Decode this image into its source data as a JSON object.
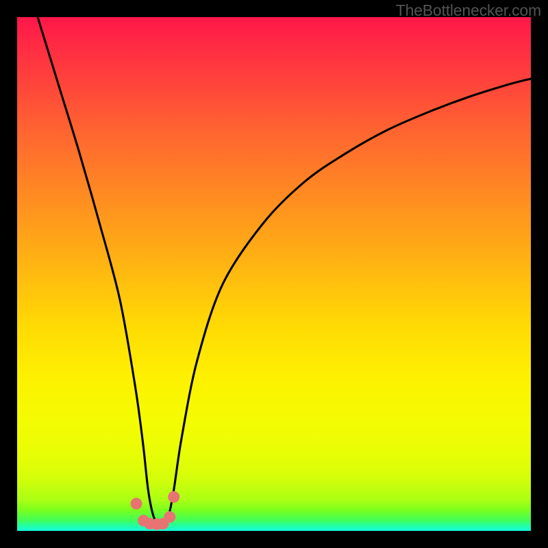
{
  "attribution": "TheBottlenecker.com",
  "chart_data": {
    "type": "line",
    "title": "",
    "xlabel": "",
    "ylabel": "",
    "xlim": [
      0,
      100
    ],
    "ylim": [
      0,
      100
    ],
    "gradient_scale": "bottleneck percentage (red = high, green = low)",
    "series": [
      {
        "name": "bottleneck-curve",
        "description": "V-shaped bottleneck curve with minimum near x≈27; left branch near-vertical, right branch rising concavely.",
        "x": [
          4,
          8,
          12,
          16,
          20,
          23,
          24.5,
          25.5,
          26.5,
          27.5,
          28.5,
          29.5,
          30.5,
          32,
          35,
          40,
          48,
          56,
          64,
          72,
          80,
          88,
          96,
          100
        ],
        "y": [
          100,
          87,
          74,
          60,
          45,
          28,
          17,
          8,
          3,
          1.5,
          1.5,
          3,
          8,
          18,
          33,
          48,
          60,
          68,
          73.5,
          78,
          81.5,
          84.5,
          87,
          88
        ]
      }
    ],
    "markers": {
      "name": "highlight-dots",
      "color": "#e77373",
      "radius_px": 8.5,
      "x": [
        23.2,
        24.6,
        25.8,
        27.2,
        28.4,
        29.7,
        30.5
      ],
      "y": [
        5.3,
        2.0,
        1.4,
        1.3,
        1.4,
        2.7,
        6.6
      ]
    }
  },
  "colors": {
    "curve": "#000000",
    "marker": "#e77373",
    "background_frame": "#000000"
  }
}
